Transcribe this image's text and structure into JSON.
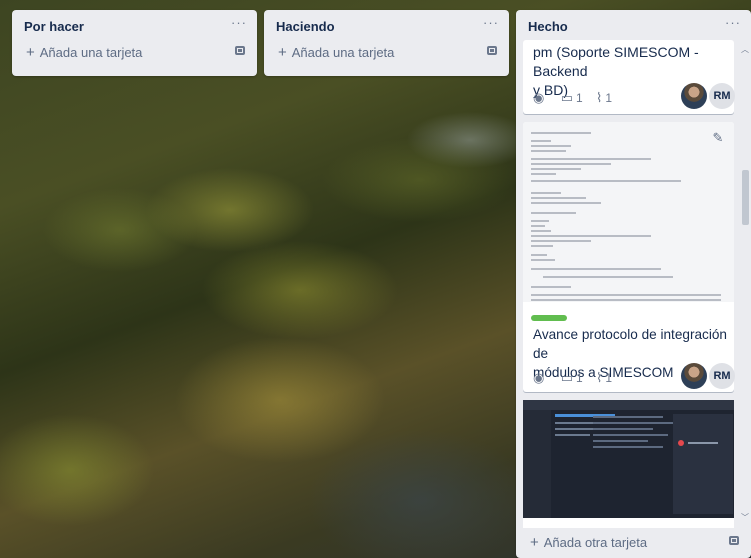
{
  "lists": [
    {
      "title": "Por hacer",
      "add_label": "Añada una tarjeta"
    },
    {
      "title": "Haciendo",
      "add_label": "Añada una tarjeta"
    },
    {
      "title": "Hecho",
      "add_label": "Añada otra tarjeta",
      "cards": [
        {
          "title_lines": [
            "pm (Soporte SIMESCOM - Backend",
            "y BD)"
          ],
          "badges": {
            "comments": "1",
            "attachments": "1"
          },
          "member_initials": "RM"
        },
        {
          "title_lines": [
            "Avance protocolo de integración de",
            "módulos a SIMESCOM"
          ],
          "label_color": "#61bd4f",
          "badges": {
            "comments": "1",
            "attachments": "1"
          },
          "member_initials": "RM"
        }
      ]
    }
  ],
  "more_glyph": "···",
  "icons": {
    "more": "more-horizontal-icon",
    "template": "card-template-icon",
    "watch": "eye-icon",
    "comment": "comment-icon",
    "attachment": "paperclip-icon",
    "edit": "pencil-icon"
  }
}
